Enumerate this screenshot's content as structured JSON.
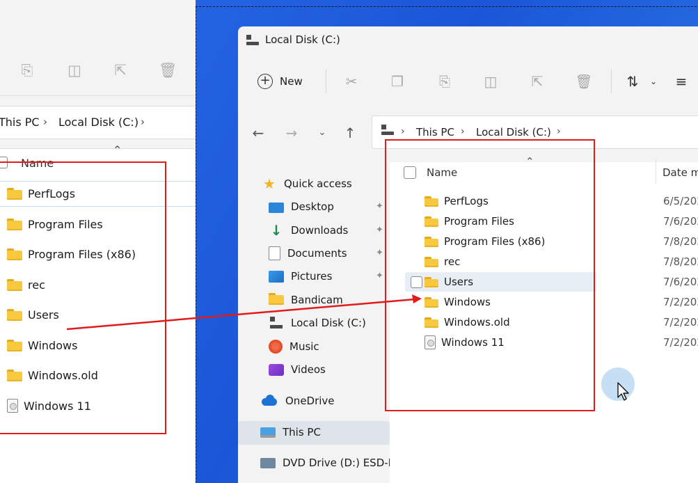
{
  "left_window": {
    "breadcrumb": [
      "This PC",
      "Local Disk (C:)"
    ],
    "column_name": "Name",
    "files": [
      {
        "name": "PerfLogs",
        "type": "folder"
      },
      {
        "name": "Program Files",
        "type": "folder"
      },
      {
        "name": "Program Files (x86)",
        "type": "folder"
      },
      {
        "name": "rec",
        "type": "folder"
      },
      {
        "name": "Users",
        "type": "folder"
      },
      {
        "name": "Windows",
        "type": "folder"
      },
      {
        "name": "Windows.old",
        "type": "folder"
      },
      {
        "name": "Windows 11",
        "type": "file"
      }
    ]
  },
  "main_window": {
    "title": "Local Disk (C:)",
    "toolbar": {
      "new_label": "New",
      "icons": [
        "cut-icon",
        "copy-icon",
        "paste-icon",
        "rename-icon",
        "share-icon",
        "delete-icon",
        "sort-icon",
        "view-icon"
      ]
    },
    "breadcrumb": [
      "This PC",
      "Local Disk (C:)"
    ],
    "nav_pane": {
      "quick_access": "Quick access",
      "items": [
        {
          "label": "Desktop",
          "icon": "desktop-icon",
          "pinned": true
        },
        {
          "label": "Downloads",
          "icon": "downloads-icon",
          "pinned": true
        },
        {
          "label": "Documents",
          "icon": "documents-icon",
          "pinned": true
        },
        {
          "label": "Pictures",
          "icon": "pictures-icon",
          "pinned": true
        },
        {
          "label": "Bandicam",
          "icon": "folder-icon",
          "pinned": false
        },
        {
          "label": "Local Disk (C:)",
          "icon": "drive-icon",
          "pinned": false
        },
        {
          "label": "Music",
          "icon": "music-icon",
          "pinned": false
        },
        {
          "label": "Videos",
          "icon": "videos-icon",
          "pinned": false
        }
      ],
      "onedrive": "OneDrive",
      "this_pc": "This PC",
      "dvd_drive": "DVD Drive (D:) ESD-IS"
    },
    "columns": {
      "name": "Name",
      "date": "Date m"
    },
    "files": [
      {
        "name": "PerfLogs",
        "date": "6/5/202",
        "type": "folder"
      },
      {
        "name": "Program Files",
        "date": "7/6/202",
        "type": "folder"
      },
      {
        "name": "Program Files (x86)",
        "date": "7/8/202",
        "type": "folder"
      },
      {
        "name": "rec",
        "date": "7/8/202",
        "type": "folder"
      },
      {
        "name": "Users",
        "date": "7/6/202",
        "type": "folder"
      },
      {
        "name": "Windows",
        "date": "7/2/202",
        "type": "folder"
      },
      {
        "name": "Windows.old",
        "date": "7/2/202",
        "type": "folder"
      },
      {
        "name": "Windows 11",
        "date": "7/2/202",
        "type": "file"
      }
    ]
  },
  "annotation_color": "#e11b1b"
}
